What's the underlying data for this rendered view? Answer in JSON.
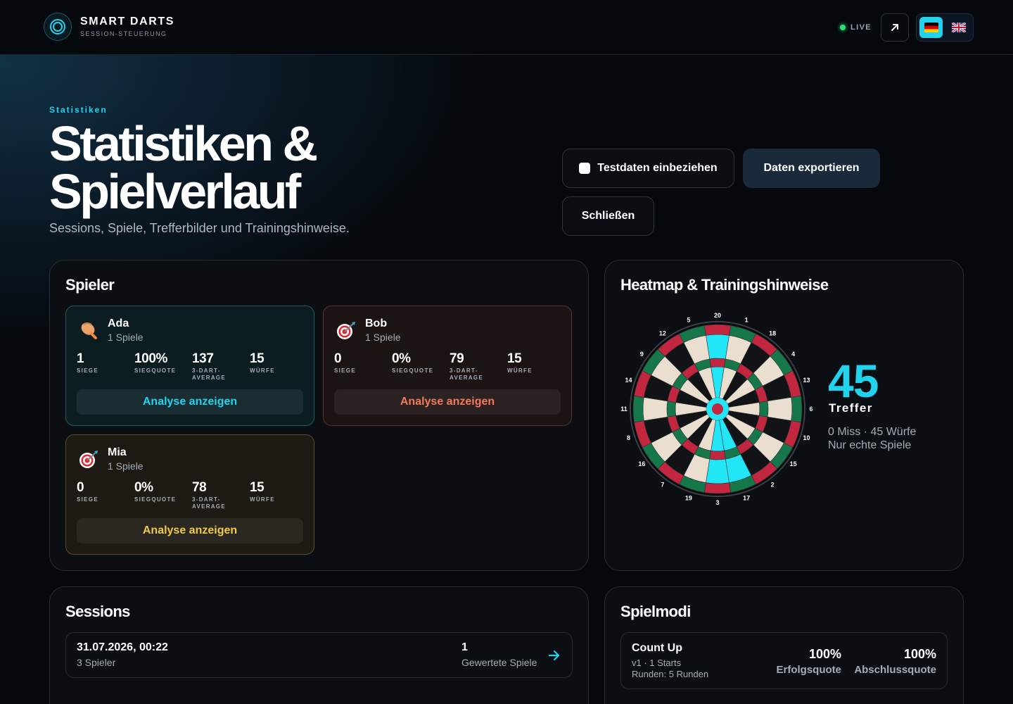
{
  "app": {
    "title": "SMART DARTS",
    "subtitle": "SESSION-STEUERUNG",
    "live_label": "LIVE"
  },
  "languages": [
    {
      "code": "de",
      "icon": "flag-de-icon",
      "active": true
    },
    {
      "code": "en",
      "icon": "flag-uk-icon",
      "active": false
    }
  ],
  "hero": {
    "eyebrow": "Statistiken",
    "title_line1": "Statistiken &",
    "title_line2": "Spielverlauf",
    "subtitle": "Sessions, Spiele, Trefferbilder und Trainingshinweise."
  },
  "actions": {
    "include_test_data": "Testdaten einbeziehen",
    "include_test_data_checked": false,
    "export": "Daten exportieren",
    "close": "Schließen"
  },
  "players_panel": {
    "title": "Spieler",
    "players": [
      {
        "name": "Ada",
        "games": "1 Spiele",
        "icon": "punch-icon",
        "wins": "1",
        "win_rate": "100%",
        "avg": "137",
        "throws": "15",
        "analyse": "Analyse anzeigen",
        "accent": "#22d3ee"
      },
      {
        "name": "Bob",
        "games": "1 Spiele",
        "icon": "dart-target-icon",
        "wins": "0",
        "win_rate": "0%",
        "avg": "79",
        "throws": "15",
        "analyse": "Analyse anzeigen",
        "accent": "#f47a5a"
      },
      {
        "name": "Mia",
        "games": "1 Spiele",
        "icon": "dart-target-icon",
        "wins": "0",
        "win_rate": "0%",
        "avg": "78",
        "throws": "15",
        "analyse": "Analyse anzeigen",
        "accent": "#f2c94c"
      }
    ],
    "labels": {
      "wins": "SIEGE",
      "win_rate": "SIEGQUOTE",
      "avg_line1": "3-DART-",
      "avg_line2": "AVERAGE",
      "throws": "WÜRFE"
    }
  },
  "heatmap_panel": {
    "title": "Heatmap & Trainingshinweise",
    "board_numbers": [
      "20",
      "1",
      "18",
      "4",
      "13",
      "6",
      "10",
      "15",
      "2",
      "17",
      "3",
      "19",
      "7",
      "16",
      "8",
      "11",
      "14",
      "9",
      "12",
      "5"
    ],
    "highlighted_segments": [
      "20",
      "17",
      "3"
    ],
    "hits": "45",
    "hits_label": "Treffer",
    "info_line1": "0 Miss · 45 Würfe",
    "info_line2": "Nur echte Spiele",
    "highlight_color": "#22e5f5"
  },
  "sessions_panel": {
    "title": "Sessions",
    "sessions": [
      {
        "date": "31.07.2026, 00:22",
        "players": "3 Spieler",
        "count": "1",
        "count_label": "Gewertete Spiele"
      }
    ]
  },
  "modes_panel": {
    "title": "Spielmodi",
    "modes": [
      {
        "name": "Count Up",
        "meta": "v1 · 1 Starts",
        "rounds": "Runden: 5 Runden",
        "success": "100%",
        "success_label": "Erfolgsquote",
        "completion": "100%",
        "completion_label": "Abschlussquote"
      }
    ]
  }
}
